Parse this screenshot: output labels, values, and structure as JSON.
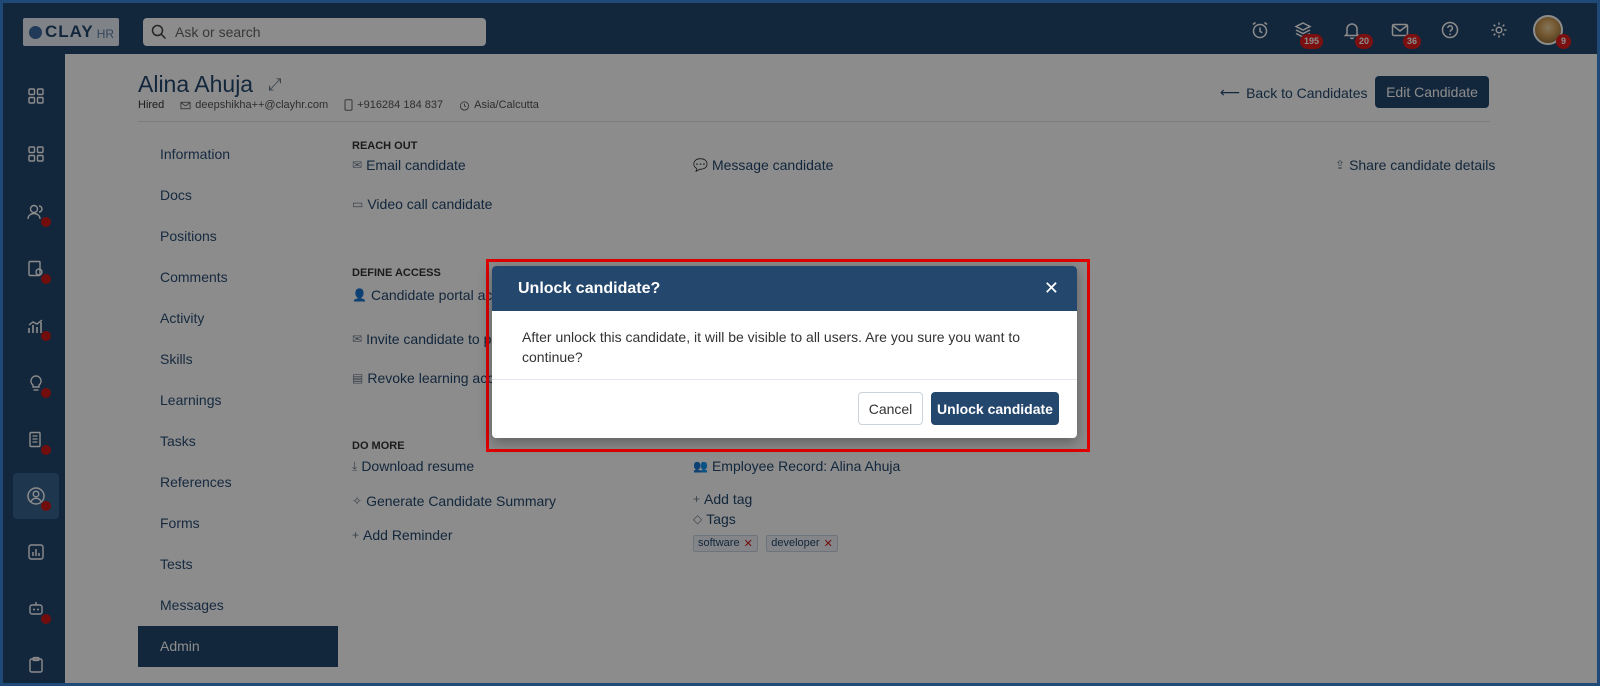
{
  "app": {
    "logo_main": "CLAY",
    "logo_sub": "HR",
    "search_placeholder": "Ask or search"
  },
  "topbar": {
    "badges": {
      "layers": "195",
      "notifications": "20",
      "mail": "36",
      "avatar": "9"
    }
  },
  "candidate": {
    "name": "Alina Ahuja",
    "status": "Hired",
    "email": "deepshikha++@clayhr.com",
    "phone": "+916284 184 837",
    "timezone": "Asia/Calcutta",
    "back_label": "Back to Candidates",
    "edit_label": "Edit Candidate"
  },
  "sidenav": {
    "items": [
      "Information",
      "Docs",
      "Positions",
      "Comments",
      "Activity",
      "Skills",
      "Learnings",
      "Tasks",
      "References",
      "Forms",
      "Tests",
      "Messages",
      "Admin"
    ],
    "active": "Admin"
  },
  "reach_out": {
    "title": "REACH OUT",
    "email": "Email candidate",
    "message": "Message candidate",
    "share": "Share candidate details",
    "video": "Video call candidate"
  },
  "define_access": {
    "title": "DEFINE ACCESS",
    "portal": "Candidate portal acc",
    "invite": "Invite candidate to p",
    "revoke": "Revoke learning acce"
  },
  "do_more": {
    "title": "DO MORE",
    "download": "Download resume",
    "summary": "Generate Candidate Summary",
    "reminder": "Add Reminder",
    "employee_record": "Employee Record: Alina Ahuja",
    "add_tag": "Add tag",
    "tags_label": "Tags",
    "tags": [
      "software",
      "developer"
    ]
  },
  "modal": {
    "title": "Unlock candidate?",
    "body": "After unlock this candidate, it will be visible to all users. Are you sure you want to continue?",
    "cancel": "Cancel",
    "confirm": "Unlock candidate"
  },
  "colors": {
    "primary": "#24476e",
    "badge": "#e21c1c",
    "highlight": "#e00000"
  }
}
